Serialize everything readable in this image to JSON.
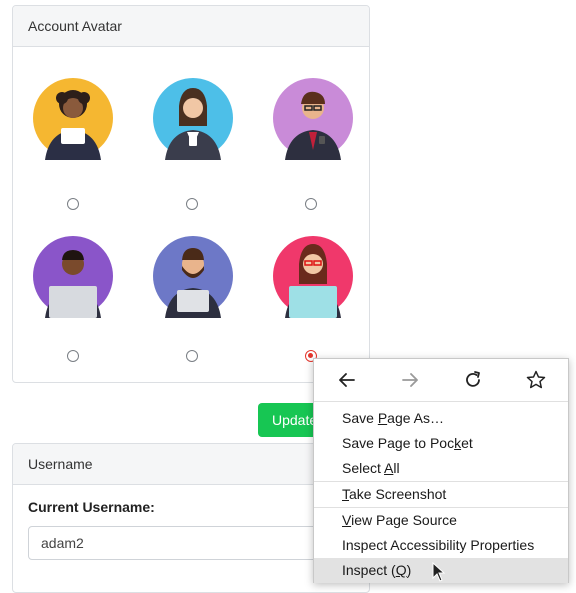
{
  "avatar_card": {
    "title": "Account Avatar",
    "avatars": [
      {
        "name": "avatar-woman-curly-hair",
        "bg": "#f5b731",
        "selected": false
      },
      {
        "name": "avatar-woman-suit",
        "bg": "#4dbfe8",
        "selected": false
      },
      {
        "name": "avatar-man-glasses",
        "bg": "#c98bd8",
        "selected": false
      },
      {
        "name": "avatar-man-laptop",
        "bg": "#8a55c9",
        "selected": false
      },
      {
        "name": "avatar-man-beard-tablet",
        "bg": "#6d78c7",
        "selected": false
      },
      {
        "name": "avatar-woman-glasses-laptop",
        "bg": "#f0386b",
        "selected": true
      }
    ]
  },
  "update_button": {
    "label": "Update"
  },
  "username_card": {
    "title": "Username",
    "current_label": "Current Username:",
    "current_value": "adam2"
  },
  "context_menu": {
    "nav": {
      "back": "back-arrow-icon",
      "forward": "forward-arrow-icon",
      "reload": "reload-icon",
      "bookmark": "star-icon"
    },
    "items": {
      "save_page_as": {
        "pre": "Save ",
        "ul": "P",
        "post": "age As…"
      },
      "save_to_pocket": {
        "pre": "Save Page to Poc",
        "ul": "k",
        "post": "et"
      },
      "select_all": {
        "pre": "Select ",
        "ul": "A",
        "post": "ll"
      },
      "take_screenshot": {
        "pre": "",
        "ul": "T",
        "post": "ake Screenshot"
      },
      "view_source": {
        "pre": "",
        "ul": "V",
        "post": "iew Page Source"
      },
      "inspect_accessibility": {
        "pre": "Inspect Accessibility Properties",
        "ul": "",
        "post": ""
      },
      "inspect": {
        "pre": "Inspect (",
        "ul": "Q",
        "post": ")"
      }
    }
  },
  "colors": {
    "accent_green": "#17c653",
    "radio_selected": "#e4362d"
  }
}
